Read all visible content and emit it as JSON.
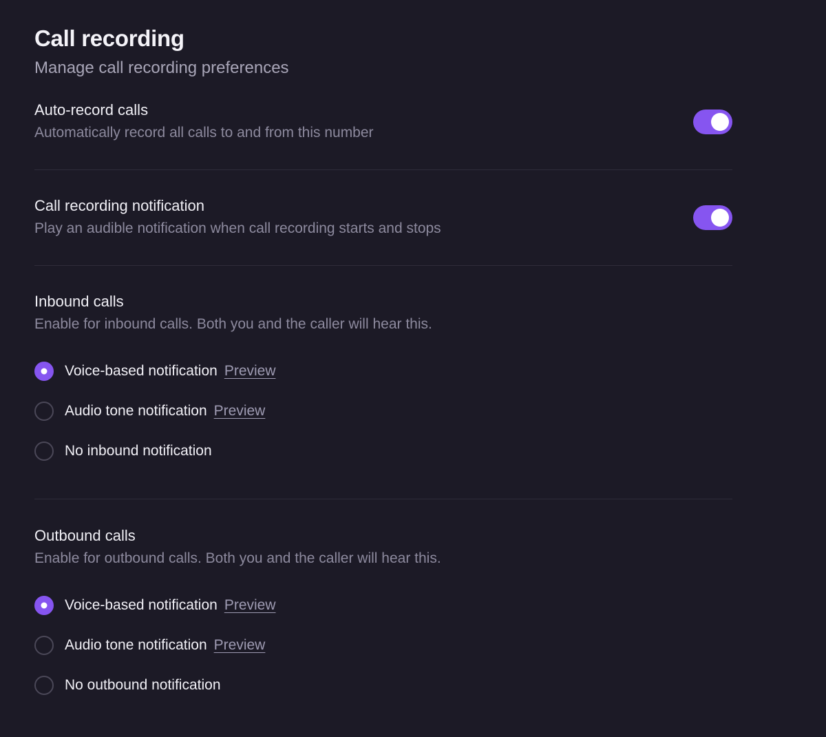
{
  "header": {
    "title": "Call recording",
    "subtitle": "Manage call recording preferences"
  },
  "auto_record": {
    "title": "Auto-record calls",
    "description": "Automatically record all calls to and from this number",
    "enabled": true
  },
  "recording_notification": {
    "title": "Call recording notification",
    "description": "Play an audible notification when call recording starts and stops",
    "enabled": true
  },
  "inbound": {
    "title": "Inbound calls",
    "description": "Enable for inbound calls. Both you and the caller will hear this.",
    "options": [
      {
        "label": "Voice-based notification",
        "link": "Preview",
        "selected": true
      },
      {
        "label": "Audio tone notification",
        "link": "Preview",
        "selected": false
      },
      {
        "label": "No inbound notification",
        "selected": false
      }
    ]
  },
  "outbound": {
    "title": "Outbound calls",
    "description": "Enable for outbound calls. Both you and the caller will hear this.",
    "options": [
      {
        "label": "Voice-based notification",
        "link": "Preview",
        "selected": true
      },
      {
        "label": "Audio tone notification",
        "link": "Preview",
        "selected": false
      },
      {
        "label": "No outbound notification",
        "selected": false
      }
    ]
  },
  "colors": {
    "background": "#1c1a26",
    "accent": "#8655f0",
    "divider": "#2f2c3a"
  }
}
